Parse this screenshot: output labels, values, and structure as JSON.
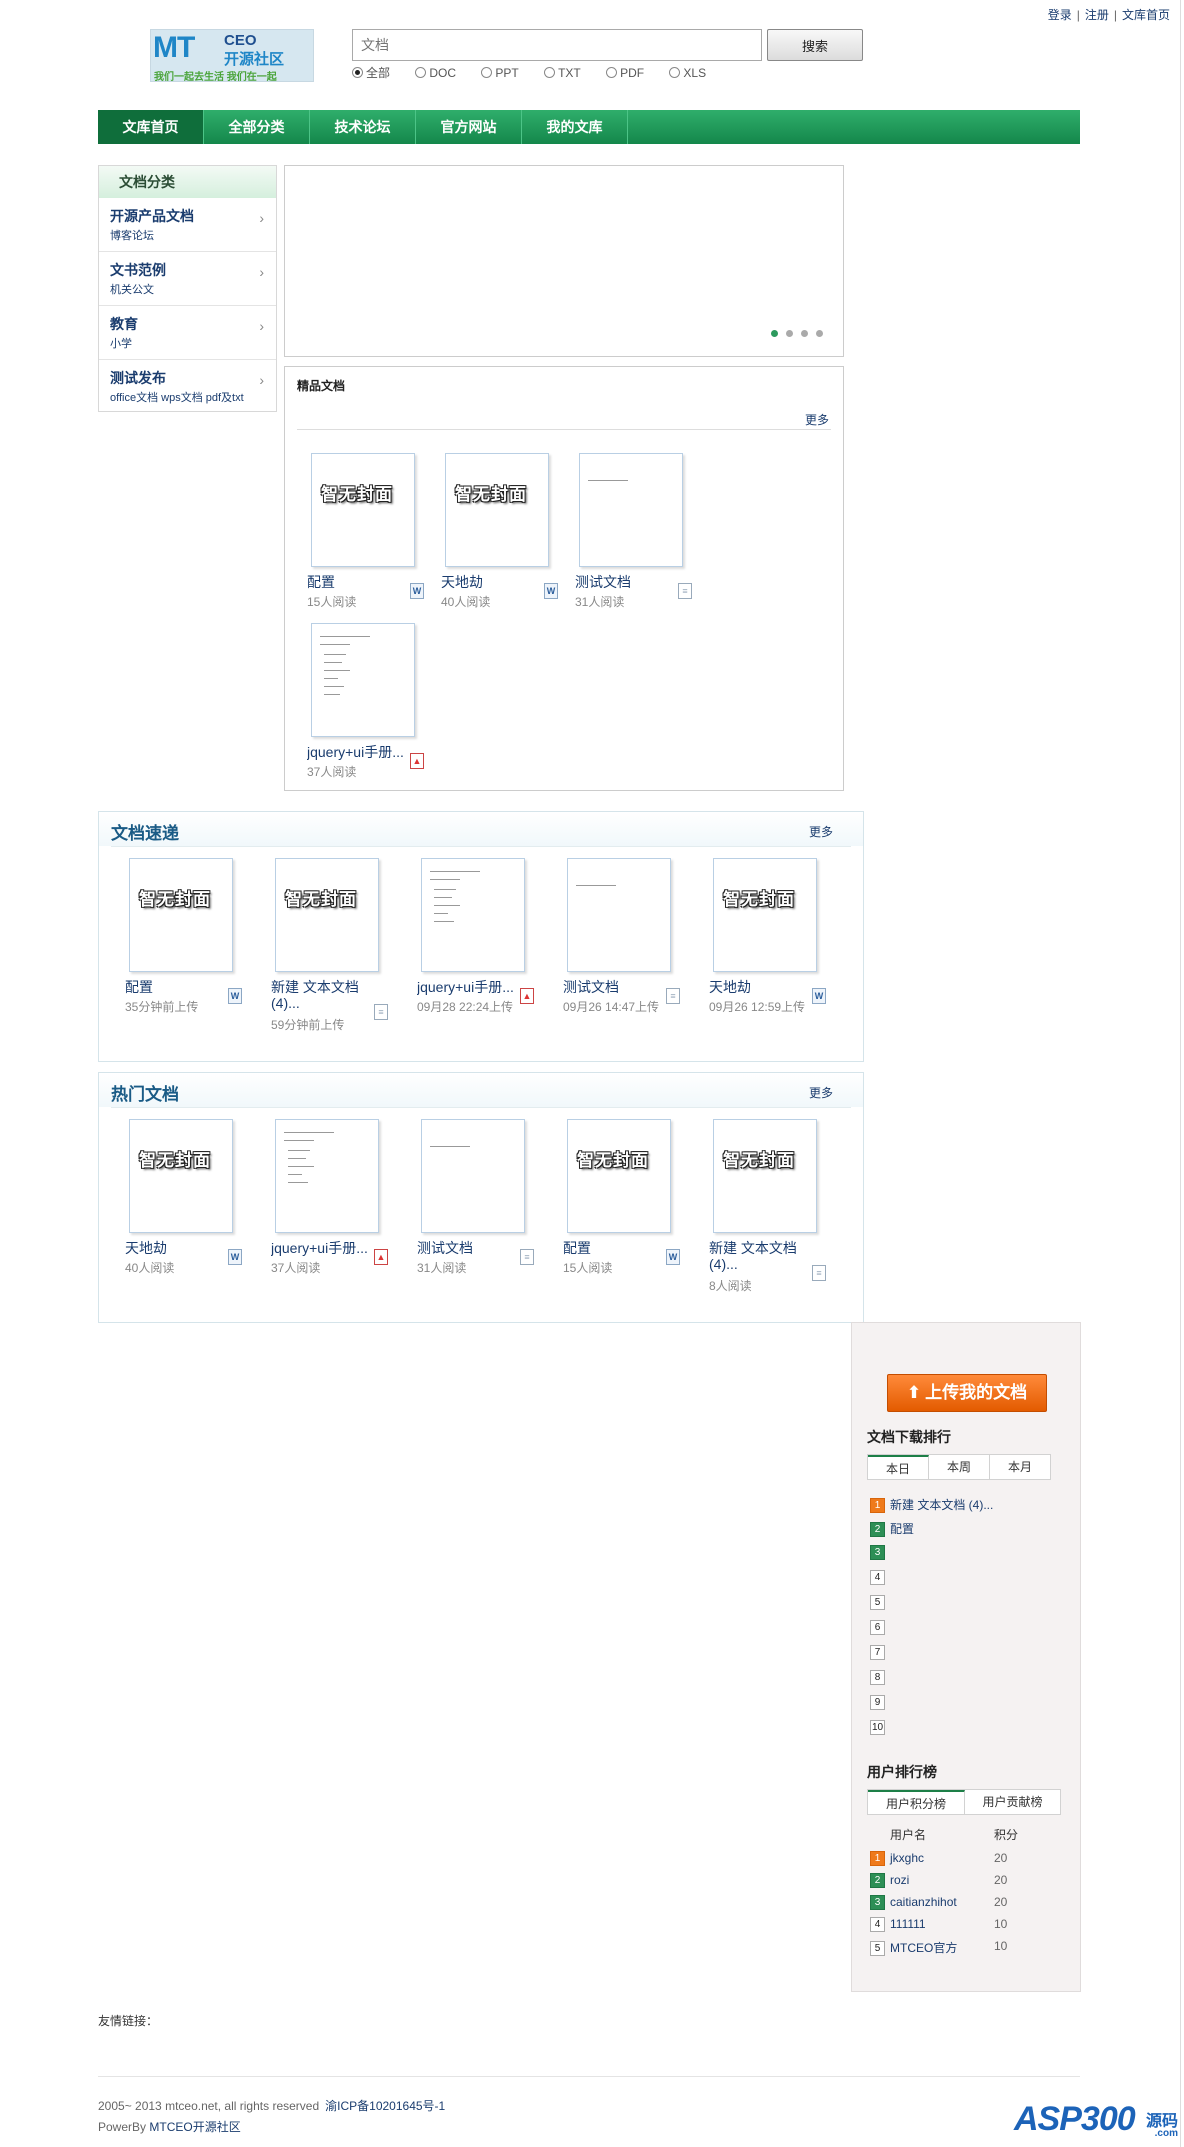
{
  "top_links": [
    "登录",
    "注册",
    "文库首页"
  ],
  "logo": {
    "mt": "MT",
    "ceo": "CEO",
    "cn": "开源社区",
    "slogan": "我们一起去生活    我们在一起"
  },
  "search": {
    "placeholder": "文档",
    "button": "搜索",
    "types": [
      "全部",
      "DOC",
      "PPT",
      "TXT",
      "PDF",
      "XLS"
    ],
    "selected": "全部"
  },
  "nav": [
    "文库首页",
    "全部分类",
    "技术论坛",
    "官方网站",
    "我的文库"
  ],
  "categories": {
    "title": "文档分类",
    "items": [
      {
        "title": "开源产品文档",
        "sub": "博客论坛"
      },
      {
        "title": "文书范例",
        "sub": "机关公文"
      },
      {
        "title": "教育",
        "sub": "小学"
      },
      {
        "title": "测试发布",
        "sub": "office文档 wps文档 pdf及txt"
      }
    ]
  },
  "featured": {
    "title": "精品文档",
    "more": "更多",
    "docs": [
      {
        "name": "配置",
        "meta": "15人阅读",
        "type": "word"
      },
      {
        "name": "天地劫",
        "meta": "40人阅读",
        "type": "word"
      },
      {
        "name": "测试文档",
        "meta": "31人阅读",
        "type": "txt"
      },
      {
        "name": "jquery+ui手册...",
        "meta": "37人阅读",
        "type": "pdf"
      }
    ]
  },
  "express": {
    "title": "文档速递",
    "more": "更多",
    "docs": [
      {
        "name": "配置",
        "meta": "35分钟前上传",
        "type": "word"
      },
      {
        "name": "新建 文本文档(4)...",
        "meta": "59分钟前上传",
        "type": "txt"
      },
      {
        "name": "jquery+ui手册...",
        "meta": "09月28 22:24上传",
        "type": "pdf"
      },
      {
        "name": "测试文档",
        "meta": "09月26 14:47上传",
        "type": "txt"
      },
      {
        "name": "天地劫",
        "meta": "09月26 12:59上传",
        "type": "word"
      }
    ]
  },
  "hot": {
    "title": "热门文档",
    "more": "更多",
    "docs": [
      {
        "name": "天地劫",
        "meta": "40人阅读",
        "type": "word"
      },
      {
        "name": "jquery+ui手册...",
        "meta": "37人阅读",
        "type": "pdf"
      },
      {
        "name": "测试文档",
        "meta": "31人阅读",
        "type": "txt"
      },
      {
        "name": "配置",
        "meta": "15人阅读",
        "type": "word"
      },
      {
        "name": "新建 文本文档(4)...",
        "meta": "8人阅读",
        "type": "txt"
      }
    ]
  },
  "sidebar": {
    "upload": "上传我的文档",
    "download_rank": {
      "title": "文档下载排行",
      "tabs": [
        "本日",
        "本周",
        "本月"
      ],
      "items": [
        "新建 文本文档 (4)...",
        "配置",
        "",
        "",
        "",
        "",
        "",
        "",
        "",
        ""
      ]
    },
    "user_rank": {
      "title": "用户排行榜",
      "tabs": [
        "用户积分榜",
        "用户贡献榜"
      ],
      "col_name": "用户名",
      "col_score": "积分",
      "users": [
        {
          "name": "jkxghc",
          "score": "20"
        },
        {
          "name": "rozi",
          "score": "20"
        },
        {
          "name": "caitianzhihot",
          "score": "20"
        },
        {
          "name": "111111",
          "score": "10"
        },
        {
          "name": "MTCEO官方",
          "score": "10"
        }
      ]
    }
  },
  "footer": {
    "friends": "友情链接：",
    "copyright": "2005~ 2013 mtceo.net, all rights reserved",
    "icp": "渝ICP备10201645号-1",
    "power_prefix": "PowerBy",
    "power_link": "MTCEO开源社区"
  },
  "watermark": {
    "asp": "ASP",
    "num": "300",
    "cn": "源码",
    "com": ".com"
  }
}
